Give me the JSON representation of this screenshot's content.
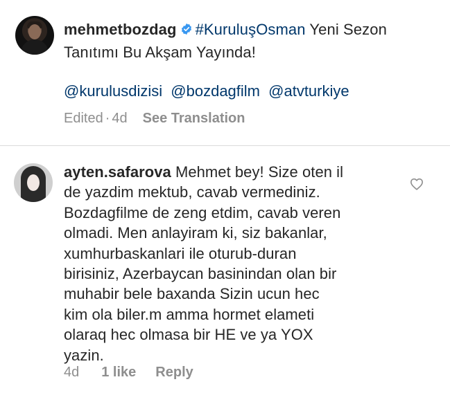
{
  "post": {
    "username": "mehmetbozdag",
    "verified_icon": "verified-badge-icon",
    "hashtag": "#KuruluşOsman",
    "caption_rest": " Yeni Sezon Tanıtımı Bu Akşam Yayında!",
    "mentions": [
      "@kurulusdizisi",
      "@bozdagfilm",
      "@atvturkiye"
    ],
    "edited_label": "Edited",
    "separator": "·",
    "age": "4d",
    "see_translation_label": "See Translation"
  },
  "comment": {
    "username": "ayten.safarova",
    "lines": [
      "Mehmet bey! Size oten il",
      "de yazdim mektub, cavab vermediniz.",
      "Bozdagfilme de zeng etdim, cavab veren",
      "olmadi. Men anlayiram ki, siz bakanlar,",
      "xumhurbaskanlari ile oturub-duran",
      "birisiniz, Azerbaycan basinindan olan bir",
      "muhabir bele baxanda Sizin ucun hec",
      "kim ola biler.m amma hormet elameti",
      "olaraq hec olmasa bir HE ve ya YOX",
      "yazin."
    ],
    "age": "4d",
    "likes_label": "1 like",
    "reply_label": "Reply",
    "like_icon": "heart-outline-icon"
  },
  "colors": {
    "text": "#262626",
    "link": "#00376b",
    "muted": "#8e8e8e",
    "verified": "#3897f0",
    "divider": "#dbdbdb"
  }
}
